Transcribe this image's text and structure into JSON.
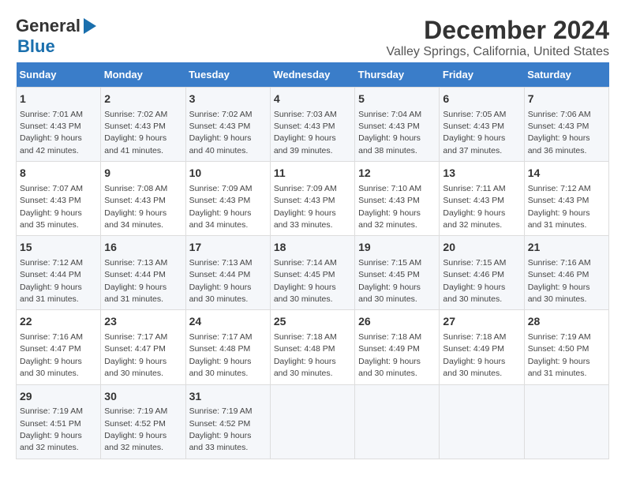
{
  "header": {
    "logo_line1": "General",
    "logo_line2": "Blue",
    "title": "December 2024",
    "subtitle": "Valley Springs, California, United States"
  },
  "calendar": {
    "days_of_week": [
      "Sunday",
      "Monday",
      "Tuesday",
      "Wednesday",
      "Thursday",
      "Friday",
      "Saturday"
    ],
    "weeks": [
      [
        {
          "day": "1",
          "detail": "Sunrise: 7:01 AM\nSunset: 4:43 PM\nDaylight: 9 hours and 42 minutes."
        },
        {
          "day": "2",
          "detail": "Sunrise: 7:02 AM\nSunset: 4:43 PM\nDaylight: 9 hours and 41 minutes."
        },
        {
          "day": "3",
          "detail": "Sunrise: 7:02 AM\nSunset: 4:43 PM\nDaylight: 9 hours and 40 minutes."
        },
        {
          "day": "4",
          "detail": "Sunrise: 7:03 AM\nSunset: 4:43 PM\nDaylight: 9 hours and 39 minutes."
        },
        {
          "day": "5",
          "detail": "Sunrise: 7:04 AM\nSunset: 4:43 PM\nDaylight: 9 hours and 38 minutes."
        },
        {
          "day": "6",
          "detail": "Sunrise: 7:05 AM\nSunset: 4:43 PM\nDaylight: 9 hours and 37 minutes."
        },
        {
          "day": "7",
          "detail": "Sunrise: 7:06 AM\nSunset: 4:43 PM\nDaylight: 9 hours and 36 minutes."
        }
      ],
      [
        {
          "day": "8",
          "detail": "Sunrise: 7:07 AM\nSunset: 4:43 PM\nDaylight: 9 hours and 35 minutes."
        },
        {
          "day": "9",
          "detail": "Sunrise: 7:08 AM\nSunset: 4:43 PM\nDaylight: 9 hours and 34 minutes."
        },
        {
          "day": "10",
          "detail": "Sunrise: 7:09 AM\nSunset: 4:43 PM\nDaylight: 9 hours and 34 minutes."
        },
        {
          "day": "11",
          "detail": "Sunrise: 7:09 AM\nSunset: 4:43 PM\nDaylight: 9 hours and 33 minutes."
        },
        {
          "day": "12",
          "detail": "Sunrise: 7:10 AM\nSunset: 4:43 PM\nDaylight: 9 hours and 32 minutes."
        },
        {
          "day": "13",
          "detail": "Sunrise: 7:11 AM\nSunset: 4:43 PM\nDaylight: 9 hours and 32 minutes."
        },
        {
          "day": "14",
          "detail": "Sunrise: 7:12 AM\nSunset: 4:43 PM\nDaylight: 9 hours and 31 minutes."
        }
      ],
      [
        {
          "day": "15",
          "detail": "Sunrise: 7:12 AM\nSunset: 4:44 PM\nDaylight: 9 hours and 31 minutes."
        },
        {
          "day": "16",
          "detail": "Sunrise: 7:13 AM\nSunset: 4:44 PM\nDaylight: 9 hours and 31 minutes."
        },
        {
          "day": "17",
          "detail": "Sunrise: 7:13 AM\nSunset: 4:44 PM\nDaylight: 9 hours and 30 minutes."
        },
        {
          "day": "18",
          "detail": "Sunrise: 7:14 AM\nSunset: 4:45 PM\nDaylight: 9 hours and 30 minutes."
        },
        {
          "day": "19",
          "detail": "Sunrise: 7:15 AM\nSunset: 4:45 PM\nDaylight: 9 hours and 30 minutes."
        },
        {
          "day": "20",
          "detail": "Sunrise: 7:15 AM\nSunset: 4:46 PM\nDaylight: 9 hours and 30 minutes."
        },
        {
          "day": "21",
          "detail": "Sunrise: 7:16 AM\nSunset: 4:46 PM\nDaylight: 9 hours and 30 minutes."
        }
      ],
      [
        {
          "day": "22",
          "detail": "Sunrise: 7:16 AM\nSunset: 4:47 PM\nDaylight: 9 hours and 30 minutes."
        },
        {
          "day": "23",
          "detail": "Sunrise: 7:17 AM\nSunset: 4:47 PM\nDaylight: 9 hours and 30 minutes."
        },
        {
          "day": "24",
          "detail": "Sunrise: 7:17 AM\nSunset: 4:48 PM\nDaylight: 9 hours and 30 minutes."
        },
        {
          "day": "25",
          "detail": "Sunrise: 7:18 AM\nSunset: 4:48 PM\nDaylight: 9 hours and 30 minutes."
        },
        {
          "day": "26",
          "detail": "Sunrise: 7:18 AM\nSunset: 4:49 PM\nDaylight: 9 hours and 30 minutes."
        },
        {
          "day": "27",
          "detail": "Sunrise: 7:18 AM\nSunset: 4:49 PM\nDaylight: 9 hours and 30 minutes."
        },
        {
          "day": "28",
          "detail": "Sunrise: 7:19 AM\nSunset: 4:50 PM\nDaylight: 9 hours and 31 minutes."
        }
      ],
      [
        {
          "day": "29",
          "detail": "Sunrise: 7:19 AM\nSunset: 4:51 PM\nDaylight: 9 hours and 32 minutes."
        },
        {
          "day": "30",
          "detail": "Sunrise: 7:19 AM\nSunset: 4:52 PM\nDaylight: 9 hours and 32 minutes."
        },
        {
          "day": "31",
          "detail": "Sunrise: 7:19 AM\nSunset: 4:52 PM\nDaylight: 9 hours and 33 minutes."
        },
        null,
        null,
        null,
        null
      ]
    ]
  }
}
